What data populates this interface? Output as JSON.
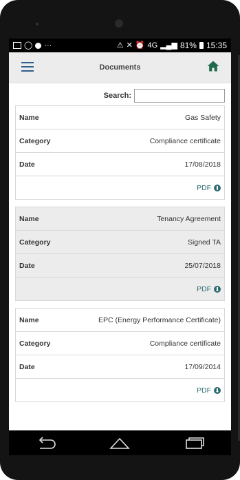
{
  "status": {
    "battery": "81%",
    "time": "15:35",
    "signal_label": "4G"
  },
  "appbar": {
    "title": "Documents"
  },
  "search": {
    "label": "Search:",
    "value": "",
    "placeholder": ""
  },
  "fields": {
    "name": "Name",
    "category": "Category",
    "date": "Date",
    "pdf": "PDF"
  },
  "documents": [
    {
      "name": "Gas Safety",
      "category": "Compliance certificate",
      "date": "17/08/2018"
    },
    {
      "name": "Tenancy Agreement",
      "category": "Signed TA",
      "date": "25/07/2018"
    },
    {
      "name": "EPC (Energy Performance Certificate)",
      "category": "Compliance certificate",
      "date": "17/09/2014"
    }
  ],
  "colors": {
    "accent": "#2d6b72",
    "menu": "#2f5f8a",
    "home": "#1f6b4b"
  },
  "icons": [
    "menu-icon",
    "home-icon",
    "pdf-download-icon",
    "back-icon",
    "home-nav-icon",
    "recents-icon"
  ]
}
